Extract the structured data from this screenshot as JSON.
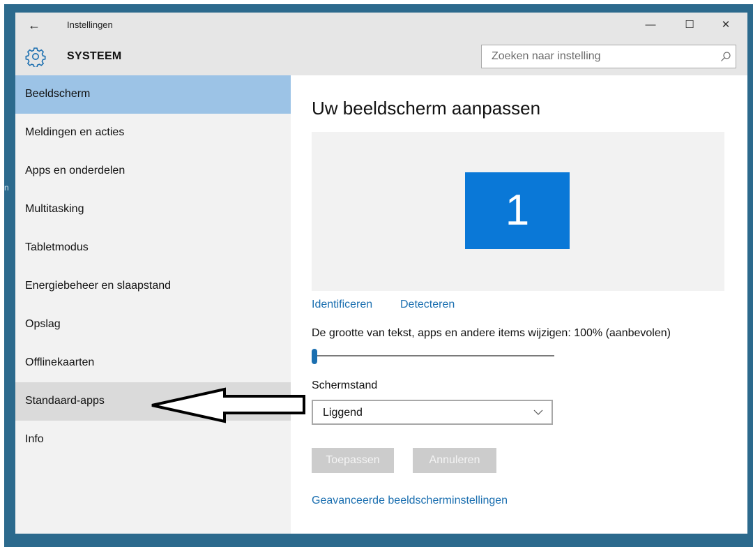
{
  "window": {
    "title": "Instellingen",
    "back_icon": "←",
    "minimize_icon": "—",
    "maximize_icon": "☐",
    "close_icon": "✕"
  },
  "header": {
    "section_title": "SYSTEEM",
    "search_placeholder": "Zoeken naar instelling"
  },
  "sidebar": {
    "items": [
      {
        "label": "Beeldscherm",
        "state": "selected"
      },
      {
        "label": "Meldingen en acties"
      },
      {
        "label": "Apps en onderdelen"
      },
      {
        "label": "Multitasking"
      },
      {
        "label": "Tabletmodus"
      },
      {
        "label": "Energiebeheer en slaapstand"
      },
      {
        "label": "Opslag"
      },
      {
        "label": "Offlinekaarten"
      },
      {
        "label": "Standaard-apps",
        "state": "hover"
      },
      {
        "label": "Info"
      }
    ]
  },
  "main": {
    "title": "Uw beeldscherm aanpassen",
    "monitor_number": "1",
    "identify_link": "Identificeren",
    "detect_link": "Detecteren",
    "scale_label": "De grootte van tekst, apps en andere items wijzigen:  100% (aanbevolen)",
    "scale_slider_fraction": 0,
    "orientation_label": "Schermstand",
    "orientation_value": "Liggend",
    "apply_button": "Toepassen",
    "cancel_button": "Annuleren",
    "advanced_link": "Geavanceerde beeldscherminstellingen"
  },
  "colors": {
    "accent": "#0a78d7",
    "link": "#1b6fb0",
    "selected_nav": "#9cc3e6",
    "frame": "#2c6a8d"
  }
}
